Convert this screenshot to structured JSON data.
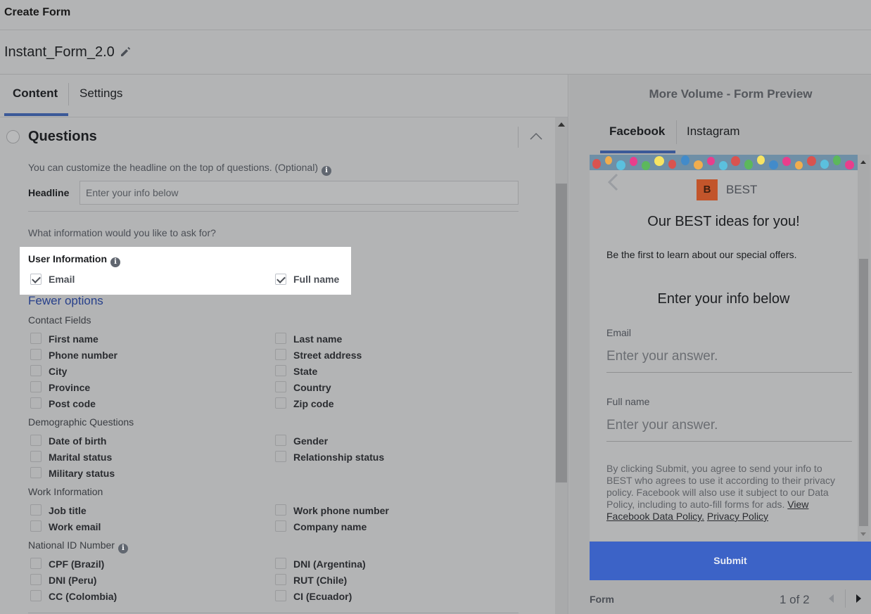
{
  "header": {
    "title": "Create Form"
  },
  "form": {
    "name": "Instant_Form_2.0",
    "edit_icon": "pencil-icon"
  },
  "tabs": [
    {
      "label": "Content",
      "active": true
    },
    {
      "label": "Settings",
      "active": false
    }
  ],
  "questions": {
    "title": "Questions",
    "headline_hint": "You can customize the headline on the top of questions. (Optional)",
    "headline_label": "Headline",
    "headline_placeholder": "Enter your info below",
    "ask_hint": "What information would you like to ask for?",
    "user_info": {
      "title": "User Information",
      "items": [
        {
          "label": "Email",
          "checked": true
        },
        {
          "label": "Full name",
          "checked": true
        }
      ]
    },
    "fewer_options": "Fewer options",
    "contact_fields": {
      "title": "Contact Fields",
      "items": [
        "First name",
        "Last name",
        "Phone number",
        "Street address",
        "City",
        "State",
        "Province",
        "Country",
        "Post code",
        "Zip code"
      ]
    },
    "demographic": {
      "title": "Demographic Questions",
      "items": [
        "Date of birth",
        "Gender",
        "Marital status",
        "Relationship status",
        "Military status"
      ]
    },
    "work": {
      "title": "Work Information",
      "items": [
        "Job title",
        "Work phone number",
        "Work email",
        "Company name"
      ]
    },
    "national_id": {
      "title": "National ID Number",
      "items": [
        "CPF (Brazil)",
        "DNI (Argentina)",
        "DNI (Peru)",
        "RUT (Chile)",
        "CC (Colombia)",
        "CI (Ecuador)"
      ]
    }
  },
  "preview": {
    "title": "More Volume - Form Preview",
    "tabs": [
      {
        "label": "Facebook",
        "active": true
      },
      {
        "label": "Instagram",
        "active": false
      }
    ],
    "brand_initial": "B",
    "brand_name": "BEST",
    "headline": "Our BEST ideas for you!",
    "description": "Be the first to learn about our special offers.",
    "sub_headline": "Enter your info below",
    "fields": [
      {
        "label": "Email",
        "placeholder": "Enter your answer."
      },
      {
        "label": "Full name",
        "placeholder": "Enter your answer."
      }
    ],
    "legal_text": "By clicking Submit, you agree to send your info to BEST who agrees to use it according to their privacy policy. Facebook will also use it subject to our Data Policy, including to auto-fill forms for ads.",
    "legal_link1": "View Facebook Data Policy.",
    "legal_link2": "Privacy Policy",
    "submit_label": "Submit",
    "footer_label": "Form",
    "page_indicator": "1 of 2"
  },
  "colors": {
    "accent": "#3b5998",
    "submit": "#3c63c7",
    "background": "#b3b4b5"
  }
}
